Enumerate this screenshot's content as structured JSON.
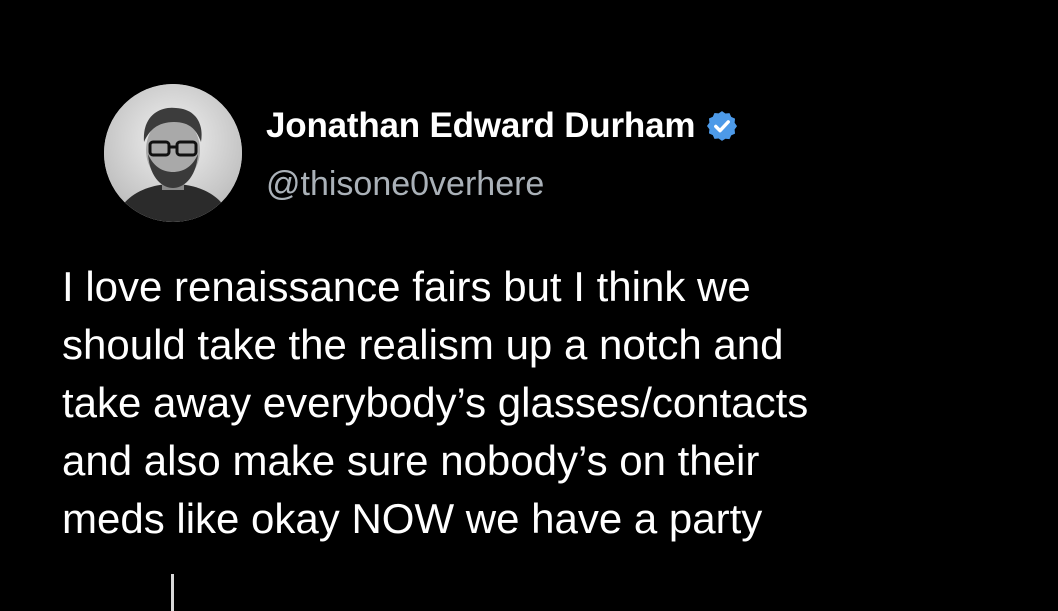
{
  "author": {
    "display_name": "Jonathan Edward Durham",
    "handle": "@thisone0verhere",
    "avatar_icon": "person-avatar-icon",
    "verified_icon": "verified-badge-icon",
    "verified_color": "#4d9ae8"
  },
  "tweet": {
    "lines": [
      "I love renaissance fairs but I think we",
      "should take the realism up a notch and",
      "take away everybody’s glasses/contacts",
      "and also make sure nobody’s on their",
      "meds like okay NOW we have a party"
    ]
  },
  "colors": {
    "background": "#000000",
    "text": "#ffffff",
    "handle": "#aab1b8"
  }
}
